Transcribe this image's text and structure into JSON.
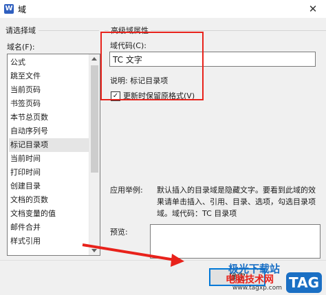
{
  "window": {
    "title": "域",
    "close_glyph": "✕",
    "app_icon_letter": "W"
  },
  "left_group": {
    "title": "请选择域",
    "field_names_label": "域名(F):",
    "items": [
      "公式",
      "跳至文件",
      "当前页码",
      "书签页码",
      "本节总页数",
      "自动序列号",
      "标记目录项",
      "当前时间",
      "打印时间",
      "创建目录",
      "文档的页数",
      "文档变量的值",
      "邮件合并",
      "样式引用"
    ],
    "selected_index": 6
  },
  "right_group": {
    "title": "高级域属性",
    "field_code_label": "域代码(C):",
    "field_code_value": "TC 文字",
    "description": "说明: 标记目录项",
    "checkbox_label": "更新时保留原格式(V)",
    "checkbox_checked": true,
    "checkbox_mark": "✓",
    "example_label": "应用举例:",
    "example_text": "默认插入的目录域是隐藏文字。要看到此域的效果请单击插入、引用、目录、选项，勾选目录项域。域代码：TC 目录项",
    "preview_label": "预览:"
  },
  "buttons": {
    "ok_label": "确定"
  },
  "watermark": {
    "line1": "极光下载站",
    "line2": "电脑技术网",
    "tag": "TAG",
    "url": "www.tagxp.com"
  },
  "colors": {
    "highlight_red": "#e8221b",
    "accent_blue": "#0078d7"
  }
}
